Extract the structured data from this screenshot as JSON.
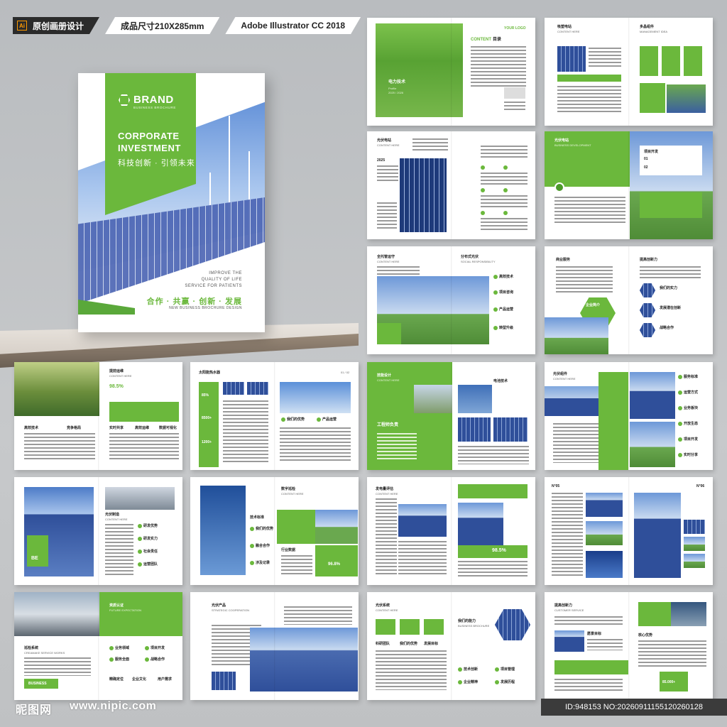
{
  "header": {
    "tag_design": "原创画册设计",
    "tag_size": "成品尺寸210X285mm",
    "tag_software": "Adobe Illustrator CC 2018",
    "ai_icon": "Ai"
  },
  "cover": {
    "brand": "BRAND",
    "brand_sub": "BUSINESS BROCHURE",
    "title_line1": "CORPORATE",
    "title_line2": "INVESTMENT",
    "cn_slogan": "科技创新 · 引领未来",
    "improve_line1": "IMPROVE THE",
    "improve_line2": "QUALITY OF LIFE",
    "improve_line3": "SERVICE FOR PATIENTS",
    "cn_slogan2": "合作 · 共赢 · 创新 · 发展",
    "sub2": "NEW BUSINESS BROCHURE DESIGN"
  },
  "spreads": {
    "s1": {
      "content": "CONTENT",
      "content_cn": "目录",
      "your_logo": "YOUR LOGO",
      "left_title": "电力技术",
      "left_sub": "Profile",
      "left_sub2": "2025 / 2026"
    },
    "s2": {
      "left_title": "吸塑电站",
      "left_sub": "CONTENT HERE",
      "right_title": "多晶组件",
      "right_sub": "MANAGEMENT IDEA"
    },
    "s3": {
      "left_title": "光伏电站",
      "left_sub": "CONTENT HERE",
      "year": "2025"
    },
    "s4": {
      "left_title": "光伏电站",
      "left_sub": "BUSINESS DEVELOPMENT",
      "right_title": "项目开发",
      "n1": "01",
      "n2": "02"
    },
    "s5": {
      "left_title": "全托管运守",
      "left_sub": "CONTENT HERE",
      "right_title": "分布式光伏",
      "right_sub": "SOCIAL RESPONSIBILITY",
      "i1": "高效技术",
      "i2": "项目咨询",
      "i3": "产品运营",
      "i4": "转型升级"
    },
    "s6": {
      "left_title": "商业服务",
      "right_title": "提高创新力",
      "i1": "我们的实力",
      "i2": "发展潜在创新",
      "i3": "战略合作",
      "center": "企业简介"
    },
    "s7": {
      "title": "提前运维",
      "sub": "CONTENT HERE",
      "pct": "98.5%",
      "i1": "高效技术",
      "i2": "竞争格局",
      "i3": "实时共享",
      "i4": "高效运维",
      "i5": "数据可视化"
    },
    "s8": {
      "title": "太阳能热水器",
      "pct": "85%",
      "num1": "8500+",
      "num2": "1200+",
      "page": "01 / 02",
      "i1": "我们的优势",
      "i2": "产品运营"
    },
    "s9": {
      "left_title": "技能设计",
      "left_sub": "CONTENT HERE",
      "right_title": "电池技术",
      "mid": "工程师负责"
    },
    "s10": {
      "title": "光伏组件",
      "sub": "CONTENT HERE",
      "i1": "服务标准",
      "i2": "运营方式",
      "i3": "业务板块",
      "i4": "开放生态",
      "i5": "项目开发",
      "i6": "实时分享"
    },
    "s11": {
      "title": "光伏制造",
      "sub": "CONTENT HERE",
      "tag": "BE",
      "i1": "研发优势",
      "i2": "研发实力",
      "i3": "社会责任",
      "i4": "运营团队"
    },
    "s12": {
      "title": "数字巡检",
      "sub": "CONTENT HERE",
      "i1": "技术标准",
      "i2": "我们的优势",
      "i3": "融合合作",
      "i4": "涉及记录",
      "pct": "96.8%",
      "label": "行业数据"
    },
    "s13": {
      "title": "发电量评估",
      "sub": "CONTENT HERE",
      "pct": "98.5%"
    },
    "s14": {
      "left_no": "N°05",
      "right_no": "N°06"
    },
    "s15": {
      "left_title": "巡检系统",
      "left_sub": "CREAMAKE SERVICE WORKS",
      "right_title": "资质认证",
      "right_sub": "FUTURE EXPECTATION",
      "badge": "BUSINESS",
      "i1": "业务领域",
      "i2": "项目开发",
      "i3": "服务全面",
      "i4": "战略合作",
      "i5": "精确定位",
      "i6": "企业文化",
      "i7": "用户需求"
    },
    "s16": {
      "title": "光伏产品",
      "sub": "STRATEGIC COOPERATION"
    },
    "s17": {
      "title": "光伏系统",
      "sub": "CONTENT HERE",
      "right_title": "我们的能力",
      "right_sub": "BUSINESS BROCHURE",
      "i1": "科研团队",
      "i2": "我们的优势",
      "i3": "发展目标",
      "i4": "技术创新",
      "i5": "项目管理",
      "i6": "企业精神",
      "i7": "发展历程"
    },
    "s18": {
      "title": "提高创新力",
      "sub": "CUSTOMER SERVICE",
      "i1": "愿景目标",
      "i2": "核心优势",
      "num": "85.000+"
    }
  },
  "footer": {
    "logo": "昵图网",
    "url": "www.nipic.com",
    "id": "ID:948153 NO:20260911155120260128"
  }
}
